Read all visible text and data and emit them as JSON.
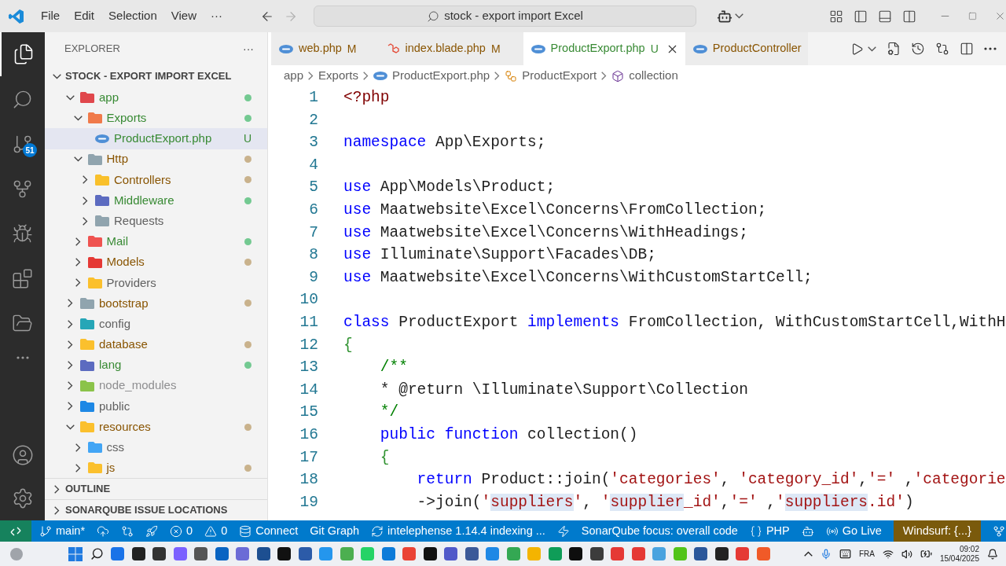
{
  "menu": [
    "File",
    "Edit",
    "Selection",
    "View",
    "···"
  ],
  "search": {
    "value": "stock - export import Excel"
  },
  "activity_bar": {
    "badge": "51"
  },
  "sidebar": {
    "title": "EXPLORER",
    "more": "···",
    "section": "STOCK - EXPORT IMPORT EXCEL",
    "tree": [
      {
        "label": "app",
        "kind": "folder",
        "expanded": true,
        "selected": false,
        "added": true,
        "modified": false,
        "dimmed": false,
        "color": "#e0474c",
        "children": [
          {
            "label": "Exports",
            "kind": "folder",
            "expanded": true,
            "selected": false,
            "added": true,
            "modified": false,
            "dimmed": false,
            "color": "#f07a4a",
            "children": [
              {
                "label": "ProductExport.php",
                "kind": "file",
                "selected": true,
                "added": true,
                "modified": false,
                "dimmed": false,
                "badge": "U"
              }
            ]
          },
          {
            "label": "Http",
            "kind": "folder",
            "expanded": true,
            "selected": false,
            "added": false,
            "modified": true,
            "dimmed": false,
            "color": "#90a4ae",
            "children": [
              {
                "label": "Controllers",
                "kind": "folder",
                "expanded": false,
                "selected": false,
                "added": false,
                "modified": true,
                "dimmed": false,
                "color": "#f9c02b"
              },
              {
                "label": "Middleware",
                "kind": "folder",
                "expanded": false,
                "selected": false,
                "added": true,
                "modified": false,
                "dimmed": false,
                "color": "#5c6bc0"
              },
              {
                "label": "Requests",
                "kind": "folder",
                "expanded": false,
                "selected": false,
                "added": false,
                "modified": false,
                "dimmed": false,
                "color": "#90a4ae"
              }
            ]
          },
          {
            "label": "Mail",
            "kind": "folder",
            "expanded": false,
            "selected": false,
            "added": true,
            "modified": false,
            "dimmed": false,
            "color": "#ef5350"
          },
          {
            "label": "Models",
            "kind": "folder",
            "expanded": false,
            "selected": false,
            "added": false,
            "modified": true,
            "dimmed": false,
            "color": "#e53935"
          },
          {
            "label": "Providers",
            "kind": "folder",
            "expanded": false,
            "selected": false,
            "added": false,
            "modified": false,
            "dimmed": false,
            "color": "#fbc02d"
          }
        ]
      },
      {
        "label": "bootstrap",
        "kind": "folder",
        "expanded": false,
        "selected": false,
        "added": false,
        "modified": true,
        "dimmed": false,
        "color": "#90a4ae"
      },
      {
        "label": "config",
        "kind": "folder",
        "expanded": false,
        "selected": false,
        "added": false,
        "modified": false,
        "dimmed": false,
        "color": "#26a6b7"
      },
      {
        "label": "database",
        "kind": "folder",
        "expanded": false,
        "selected": false,
        "added": false,
        "modified": true,
        "dimmed": false,
        "color": "#fbc02d"
      },
      {
        "label": "lang",
        "kind": "folder",
        "expanded": false,
        "selected": false,
        "added": true,
        "modified": false,
        "dimmed": false,
        "color": "#5c6bc0"
      },
      {
        "label": "node_modules",
        "kind": "folder",
        "expanded": false,
        "selected": false,
        "added": false,
        "modified": false,
        "dimmed": true,
        "color": "#8bc34a"
      },
      {
        "label": "public",
        "kind": "folder",
        "expanded": false,
        "selected": false,
        "added": false,
        "modified": false,
        "dimmed": false,
        "color": "#1e88e5"
      },
      {
        "label": "resources",
        "kind": "folder",
        "expanded": true,
        "selected": false,
        "added": false,
        "modified": true,
        "dimmed": false,
        "color": "#fbc02d",
        "children": [
          {
            "label": "css",
            "kind": "folder",
            "expanded": false,
            "selected": false,
            "added": false,
            "modified": false,
            "dimmed": false,
            "color": "#42a5f5"
          },
          {
            "label": "js",
            "kind": "folder",
            "expanded": false,
            "selected": false,
            "added": false,
            "modified": true,
            "dimmed": false,
            "color": "#fbc02d"
          }
        ]
      }
    ],
    "panels": [
      {
        "label": "OUTLINE",
        "expanded": false
      },
      {
        "label": "SONARQUBE ISSUE LOCATIONS",
        "expanded": false
      }
    ]
  },
  "tabs": [
    {
      "label": "web.php",
      "badge": "M",
      "kind": "php",
      "added": false,
      "modified": true,
      "selected": false
    },
    {
      "label": "index.blade.php",
      "badge": "M",
      "kind": "laravel",
      "added": false,
      "modified": true,
      "selected": false
    },
    {
      "label": "ProductExport.php",
      "badge": "U",
      "kind": "php",
      "added": true,
      "modified": false,
      "selected": true
    },
    {
      "label": "ProductController",
      "kind": "php",
      "added": false,
      "modified": true,
      "selected": false
    }
  ],
  "breadcrumbs": [
    {
      "label": "app",
      "kind": "folder"
    },
    {
      "label": "Exports",
      "kind": "folder"
    },
    {
      "label": "ProductExport.php",
      "kind": "php"
    },
    {
      "label": "ProductExport",
      "kind": "class"
    },
    {
      "label": "collection",
      "kind": "method"
    }
  ],
  "code": [
    {
      "number": "1",
      "tokens": [
        {
          "kind": "tag",
          "text": "<?php"
        }
      ]
    },
    {
      "number": "2"
    },
    {
      "number": "3",
      "tokens": [
        {
          "kind": "keyword",
          "text": "namespace"
        },
        {
          "kind": "plain",
          "text": " App\\Exports;"
        }
      ]
    },
    {
      "number": "4"
    },
    {
      "number": "5",
      "tokens": [
        {
          "kind": "keyword",
          "text": "use"
        },
        {
          "kind": "plain",
          "text": " App\\Models\\Product;"
        }
      ]
    },
    {
      "number": "6",
      "tokens": [
        {
          "kind": "keyword",
          "text": "use"
        },
        {
          "kind": "plain",
          "text": " Maatwebsite\\Excel\\Concerns\\FromCollection;"
        }
      ]
    },
    {
      "number": "7",
      "tokens": [
        {
          "kind": "keyword",
          "text": "use"
        },
        {
          "kind": "plain",
          "text": " Maatwebsite\\Excel\\Concerns\\WithHeadings;"
        }
      ]
    },
    {
      "number": "8",
      "tokens": [
        {
          "kind": "keyword",
          "text": "use"
        },
        {
          "kind": "plain",
          "text": " Illuminate\\Support\\Facades\\DB;"
        }
      ]
    },
    {
      "number": "9",
      "tokens": [
        {
          "kind": "keyword",
          "text": "use"
        },
        {
          "kind": "plain",
          "text": " Maatwebsite\\Excel\\Concerns\\WithCustomStartCell;"
        }
      ]
    },
    {
      "number": "10"
    },
    {
      "number": "11",
      "tokens": [
        {
          "kind": "keyword",
          "text": "class"
        },
        {
          "kind": "plain",
          "text": " ProductExport "
        },
        {
          "kind": "keyword",
          "text": "implements"
        },
        {
          "kind": "plain",
          "text": " FromCollection, WithCustomStartCell,WithH"
        }
      ]
    },
    {
      "number": "12",
      "tokens": [
        {
          "kind": "brace",
          "text": "{"
        }
      ]
    },
    {
      "number": "13",
      "tokens": [
        {
          "kind": "comment",
          "text": "    /**"
        }
      ]
    },
    {
      "number": "14",
      "tokens": [
        {
          "kind": "plain",
          "text": "    * @return \\Illuminate\\Support\\Collection"
        }
      ]
    },
    {
      "number": "15",
      "tokens": [
        {
          "kind": "comment",
          "text": "    */"
        }
      ]
    },
    {
      "number": "16",
      "tokens": [
        {
          "kind": "keyword",
          "text": "    public function"
        },
        {
          "kind": "plain",
          "text": " collection()"
        }
      ]
    },
    {
      "number": "17",
      "tokens": [
        {
          "kind": "brace",
          "text": "    {"
        }
      ]
    },
    {
      "number": "18",
      "tokens": [
        {
          "kind": "keyword",
          "text": "        return"
        },
        {
          "kind": "plain",
          "text": " Product::join("
        },
        {
          "kind": "string",
          "text": "'categories'"
        },
        {
          "kind": "plain",
          "text": ", "
        },
        {
          "kind": "string",
          "text": "'category_id'"
        },
        {
          "kind": "plain",
          "text": ","
        },
        {
          "kind": "string",
          "text": "'='"
        },
        {
          "kind": "plain",
          "text": " ,"
        },
        {
          "kind": "string",
          "text": "'categorie"
        }
      ]
    },
    {
      "number": "19",
      "tokens": [
        {
          "kind": "plain",
          "text": "        ->join("
        },
        {
          "kind": "string",
          "text": "'"
        },
        {
          "kind": "string",
          "text": "suppliers",
          "highlighted": true
        },
        {
          "kind": "string",
          "text": "'"
        },
        {
          "kind": "plain",
          "text": ", "
        },
        {
          "kind": "string",
          "text": "'"
        },
        {
          "kind": "string",
          "text": "supplier",
          "highlighted": true
        },
        {
          "kind": "string",
          "text": "_id'"
        },
        {
          "kind": "plain",
          "text": ","
        },
        {
          "kind": "string",
          "text": "'='"
        },
        {
          "kind": "plain",
          "text": " ,"
        },
        {
          "kind": "string",
          "text": "'"
        },
        {
          "kind": "string",
          "text": "suppliers",
          "highlighted": true
        },
        {
          "kind": "string",
          "text": ".id'"
        },
        {
          "kind": "plain",
          "text": ")"
        }
      ]
    }
  ],
  "status_bar": [
    {
      "kind": "branch",
      "text": "main*"
    },
    {
      "kind": "cloud"
    },
    {
      "kind": "compare"
    },
    {
      "kind": "rocket"
    },
    {
      "kind": "error",
      "text": "0"
    },
    {
      "kind": "warning",
      "text": "0"
    },
    {
      "kind": "database",
      "text": "Connect"
    },
    {
      "kind": "plain",
      "text": "Git Graph"
    },
    {
      "kind": "sync",
      "text": "intelephense 1.14.4 indexing ..."
    },
    {
      "kind": "bolt"
    },
    {
      "kind": "plain",
      "text": "SonarQube focus: overall code"
    },
    {
      "kind": "braces",
      "text": "PHP"
    },
    {
      "kind": "bot"
    },
    {
      "kind": "broadcast",
      "text": "Go Live"
    },
    {
      "kind": "plain",
      "text": "Windsurf: {...}",
      "highlighted": true
    },
    {
      "kind": "circle-branch"
    }
  ],
  "taskbar": {
    "language": "FRA",
    "time": "09:02",
    "date": "15/04/2025"
  }
}
